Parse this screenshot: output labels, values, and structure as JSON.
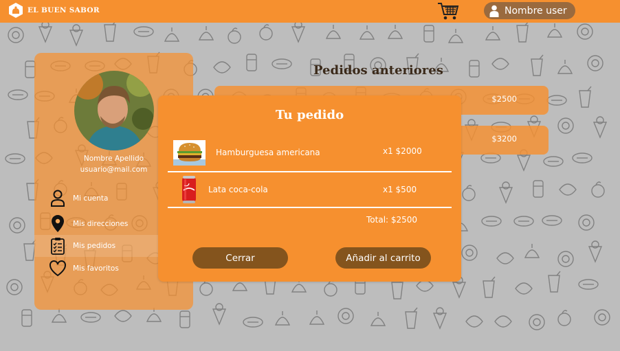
{
  "app": {
    "brand_name": "EL BUEN SABOR"
  },
  "header": {
    "user_name": "Nombre user",
    "cart_icon": "shopping-cart-icon",
    "user_icon": "user-icon"
  },
  "profile": {
    "name": "Nombre Apellido",
    "email": "usuario@mail.com",
    "menu": [
      {
        "label": "Mi cuenta",
        "icon": "person-icon"
      },
      {
        "label": "Mis direcciones",
        "icon": "location-pin-icon"
      },
      {
        "label": "Mis pedidos",
        "icon": "clipboard-list-icon"
      },
      {
        "label": "Mis favoritos",
        "icon": "heart-icon"
      }
    ]
  },
  "orders": {
    "title": "Pedidos anteriores",
    "rows": [
      {
        "price": "$2500"
      },
      {
        "price": "$3200"
      }
    ]
  },
  "modal": {
    "title": "Tu pedido",
    "items": [
      {
        "name": "Hamburguesa americana",
        "qty_price": "x1 $2000",
        "image": "burger-image"
      },
      {
        "name": "Lata coca-cola",
        "qty_price": "x1 $500",
        "image": "cola-can-image"
      }
    ],
    "total": "Total: $2500",
    "close_label": "Cerrar",
    "add_label": "Añadir al carrito"
  },
  "colors": {
    "accent": "#f6902f",
    "button": "#84541d",
    "pill": "#9a6a3e",
    "background": "#bdbdbd"
  }
}
